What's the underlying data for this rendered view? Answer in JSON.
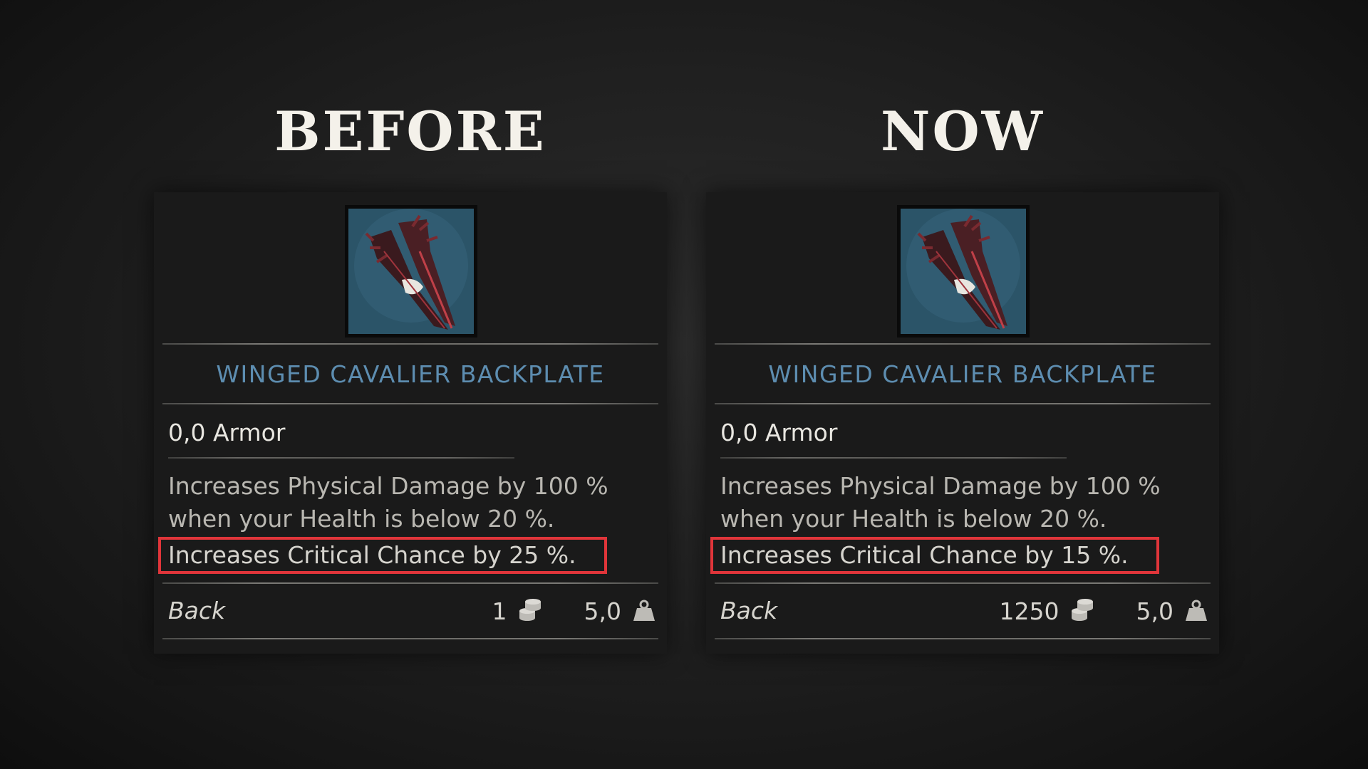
{
  "headings": {
    "before": "BEFORE",
    "now": "NOW"
  },
  "colors": {
    "item_name": "#5d8db0",
    "highlight": "#e0353a",
    "background": "#1f1f1f"
  },
  "cards": {
    "before": {
      "icon": "winged-backplate-icon",
      "name": "WINGED CAVALIER BACKPLATE",
      "armor": "0,0 Armor",
      "desc_line1": "Increases Physical Damage by 100 %",
      "desc_line2": "when your Health is below 20 %.",
      "crit": "Increases Critical Chance by 25 %.",
      "slot": "Back",
      "price": "1",
      "weight": "5,0"
    },
    "now": {
      "icon": "winged-backplate-icon",
      "name": "WINGED CAVALIER BACKPLATE",
      "armor": "0,0 Armor",
      "desc_line1": "Increases Physical Damage by 100 %",
      "desc_line2": "when your Health is below 20 %.",
      "crit": "Increases Critical Chance by 15 %.",
      "slot": "Back",
      "price": "1250",
      "weight": "5,0"
    }
  }
}
